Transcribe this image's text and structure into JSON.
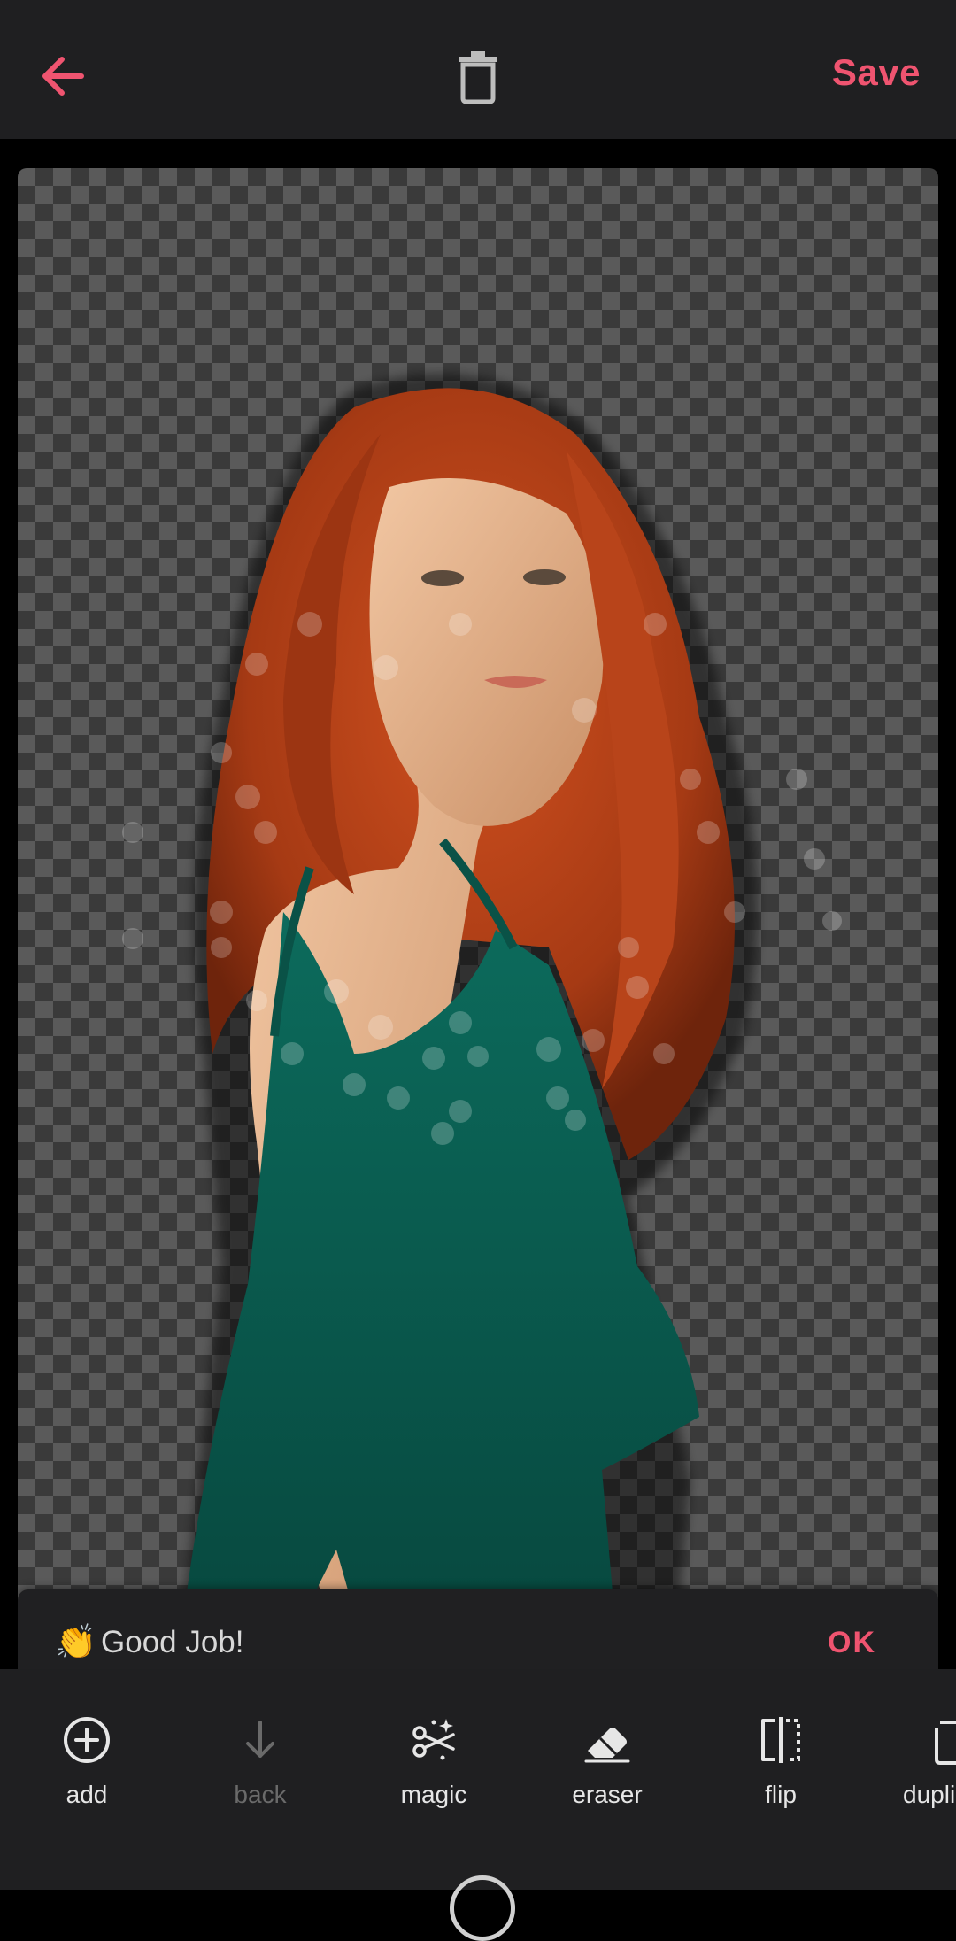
{
  "header": {
    "back_icon": "arrow-left-icon",
    "delete_icon": "trash-icon",
    "save_label": "Save"
  },
  "canvas": {
    "background": "transparent-checkerboard",
    "subject_description_icon": "cutout-portrait"
  },
  "toast": {
    "emoji": "👏",
    "message": "Good Job!",
    "ok_label": "OK"
  },
  "toolbar": {
    "items": [
      {
        "label": "add",
        "icon": "plus-circle-icon"
      },
      {
        "label": "back",
        "icon": "arrow-down-icon"
      },
      {
        "label": "magic",
        "icon": "magic-scissors-icon"
      },
      {
        "label": "eraser",
        "icon": "eraser-icon"
      },
      {
        "label": "flip",
        "icon": "flip-icon"
      },
      {
        "label": "dupli",
        "icon": "duplicate-icon"
      }
    ]
  },
  "colors": {
    "accent": "#ef5470",
    "bar_background": "#1f1f21",
    "toast_background": "#202022"
  }
}
